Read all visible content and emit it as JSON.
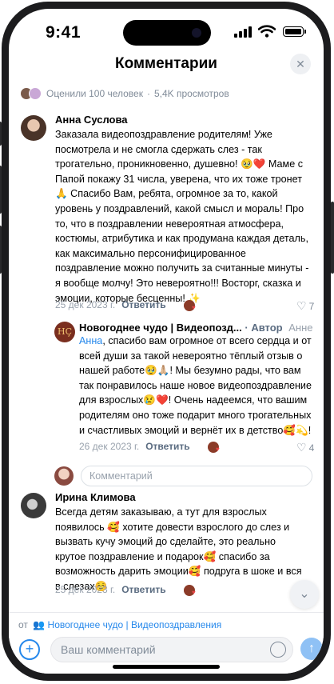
{
  "status": {
    "time": "9:41"
  },
  "header": {
    "title": "Комментарии",
    "close": "✕"
  },
  "meta": {
    "likes": "Оценили 100 человек",
    "sep": "·",
    "views": "5,4K просмотров"
  },
  "comments": [
    {
      "author": "Анна Суслова",
      "text": "Заказала видеопоздравление родителям! Уже посмотрела и не смогла сдержать слез - так трогательно, проникновенно, душевно! 🥹❤️ Маме с Папой покажу 31 числа, уверена, что их тоже тронет 🙏 Спасибо Вам, ребята,  огромное за то, какой уровень у поздравлений, какой смысл и мораль! Про то, что в поздравлении невероятная атмосфера, костюмы, атрибутика и как продумана каждая деталь, как максимально персонифицированное поздравление можно получить за считанные минуты - я вообще молчу! Это невероятно!!! Восторг, сказка и эмоции, которые бесценны!  ✨",
      "date": "25 дек 2023 г.",
      "reply": "Ответить",
      "likes": "7"
    },
    {
      "author": "Новогоднее чудо | Видеопозд...",
      "badge": "· Автор",
      "to": "Анне",
      "to_link": "Анна",
      "text": ", спасибо вам огромное от всего сердца и от всей души за такой невероятно тёплый отзыв о нашей работе🥹🙏🏼! Мы безумно рады, что вам так понравилось наше новое видеопоздравление для взрослых😢❤️! Очень надеемся, что вашим родителям оно тоже подарит много трогательных и счастливых эмоций и вернёт их в детство🥰💫!",
      "date": "26 дек 2023 г.",
      "reply": "Ответить",
      "likes": "4"
    },
    {
      "author": "Ирина Климова",
      "text": "Всегда детям заказываю, а тут для взрослых появилось 🥰 хотите довести взрослого до слез и вызвать кучу эмоций до сделайте, это реально крутое поздравление и подарок🥰 спасибо за возможность дарить эмоции🥰 подруга в шоке и вся в слезах☺️",
      "date": "25 дек 2023 г.",
      "reply": "Ответить"
    }
  ],
  "reply_input": {
    "placeholder": "Комментарий"
  },
  "bottom": {
    "from_prefix": "от",
    "from_group": "Новогоднее чудо | Видеопоздравления",
    "placeholder": "Ваш комментарий"
  },
  "colors": {
    "accent": "#2688eb",
    "secondary": "#818c99"
  }
}
